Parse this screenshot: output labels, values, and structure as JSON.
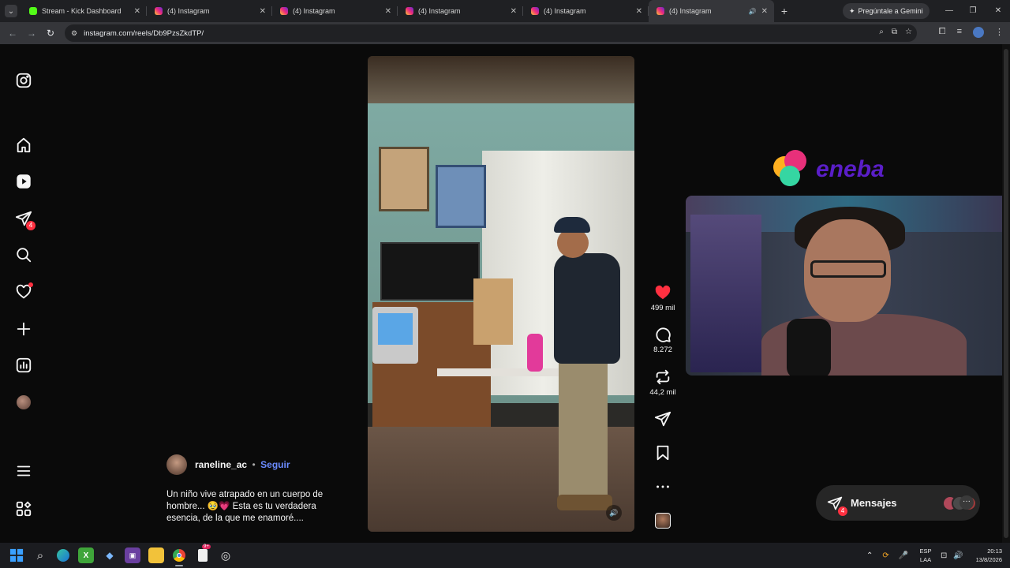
{
  "browser": {
    "tabs": [
      {
        "title": "Stream - Kick Dashboard",
        "favicon": "kick-icon",
        "active": false
      },
      {
        "title": "(4) Instagram",
        "favicon": "instagram-icon",
        "active": false
      },
      {
        "title": "(4) Instagram",
        "favicon": "instagram-icon",
        "active": false
      },
      {
        "title": "(4) Instagram",
        "favicon": "instagram-icon",
        "active": false
      },
      {
        "title": "(4) Instagram",
        "favicon": "instagram-icon",
        "active": false
      },
      {
        "title": "(4) Instagram",
        "favicon": "instagram-icon",
        "active": true,
        "audio": true
      }
    ],
    "gemini_label": "Pregúntale a Gemini",
    "url": "instagram.com/reels/Db9PzsZkdTP/"
  },
  "sidebar": {
    "messages_badge": "4"
  },
  "reel": {
    "likes": "499 mil",
    "comments": "8.272",
    "reposts": "44,2 mil",
    "author": "raneline_ac",
    "separator": "•",
    "follow_label": "Seguir",
    "caption": "Un niño vive atrapado en un cuerpo de hombre... 🥹💗 Esta es tu verdadera esencia, de la que me enamoré...."
  },
  "overlay": {
    "sponsor": "eneba"
  },
  "messages": {
    "label": "Mensajes",
    "badge": "4",
    "more": "···"
  },
  "taskbar": {
    "lang_line1": "ESP",
    "lang_line2": "LAA",
    "time": "20:13",
    "date": "13/8/2026",
    "chrome_badge": "9+"
  },
  "colors": {
    "accent_blue": "#6b8bff",
    "notification_red": "#ff3040",
    "like_red": "#ff3040",
    "eneba_purple": "#5a1ec8"
  }
}
